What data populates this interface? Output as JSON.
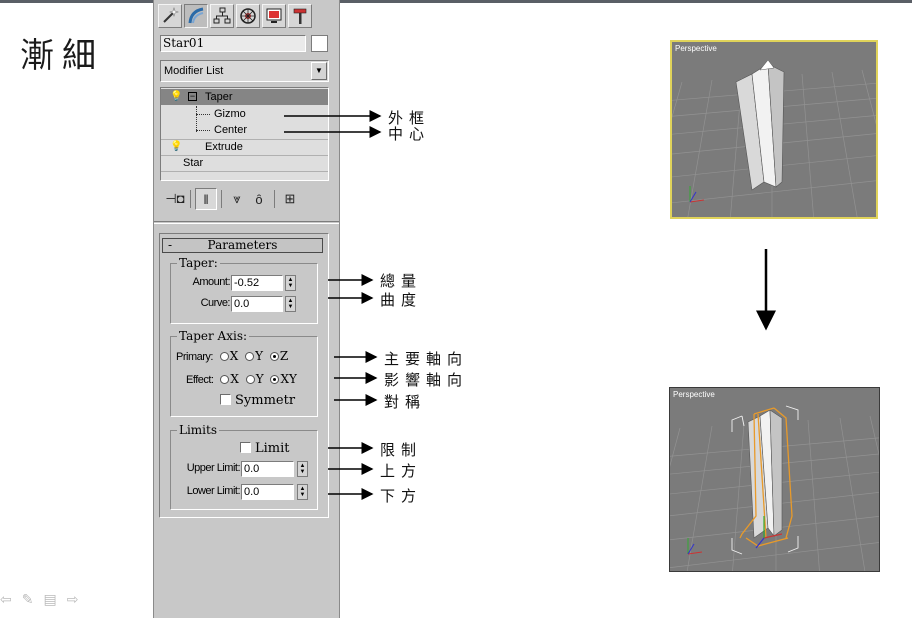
{
  "slide": {
    "title": "漸細"
  },
  "panel": {
    "object_name": "Star01",
    "modifier_list": "Modifier List",
    "stack": {
      "taper": "Taper",
      "gizmo": "Gizmo",
      "center": "Center",
      "extrude": "Extrude",
      "star": "Star"
    },
    "params": {
      "rollout_minus": "-",
      "rollout_title": "Parameters",
      "taper_group": "Taper:",
      "amount_label": "Amount:",
      "amount_value": "-0.52",
      "curve_label": "Curve:",
      "curve_value": "0.0",
      "axis_group": "Taper Axis:",
      "primary_label": "Primary:",
      "effect_label": "Effect:",
      "x": "X",
      "y": "Y",
      "z": "Z",
      "xy": "XY",
      "symmetry": "Symmetr",
      "limits_group": "Limits",
      "limit": "Limit",
      "upper_label": "Upper Limit:",
      "upper_value": "0.0",
      "lower_label": "Lower Limit:",
      "lower_value": "0.0"
    }
  },
  "annotations": {
    "gizmo": "外框",
    "center": "中心",
    "amount": "總量",
    "curve": "曲度",
    "primary": "主要軸向",
    "effect": "影響軸向",
    "symmetry": "對稱",
    "limit": "限制",
    "upper": "上方",
    "lower": "下方"
  },
  "viewports": {
    "before_label": "Perspective",
    "after_label": "Perspective"
  },
  "colors": {
    "panel_bg": "#c8c8c8",
    "viewport_bg": "#7b7b7b",
    "active_viewport_border": "#e0d35a",
    "gizmo_orange": "#e89a2a"
  }
}
